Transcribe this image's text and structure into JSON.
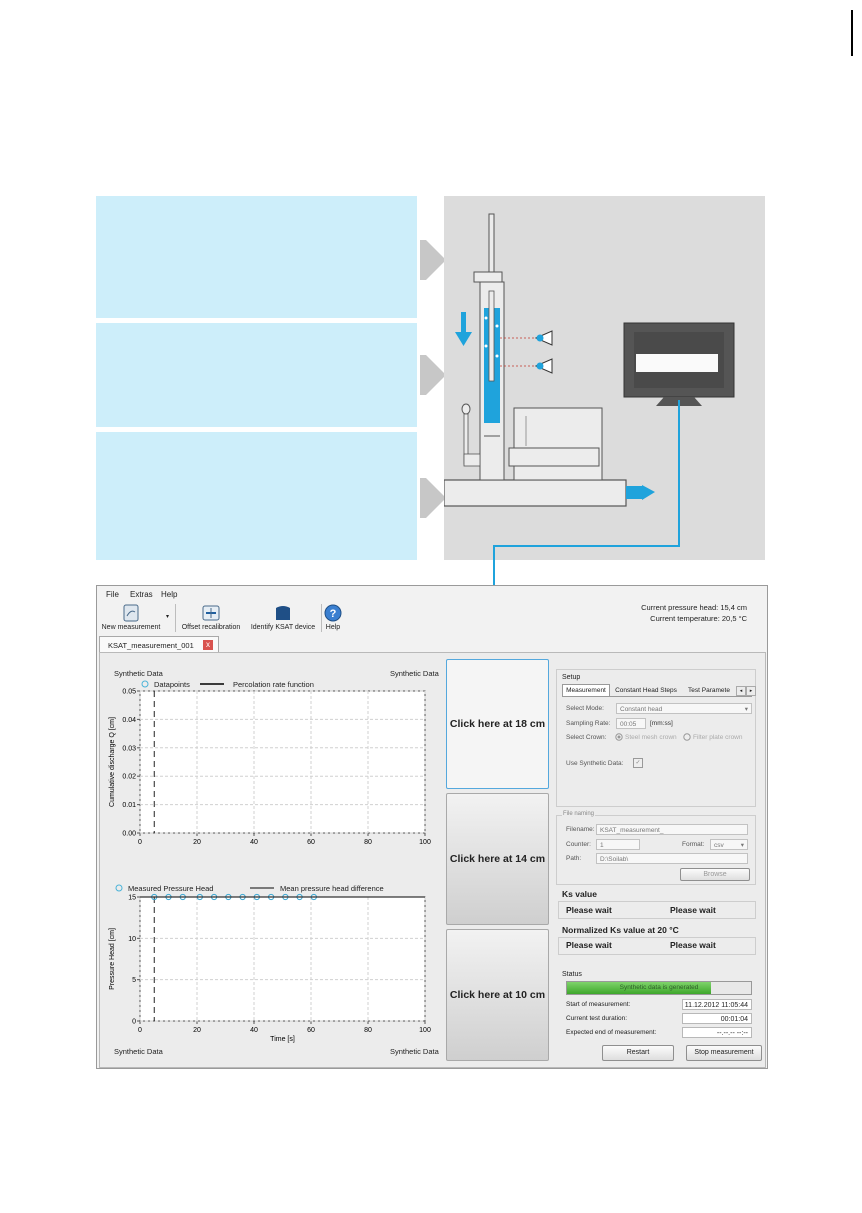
{
  "window": {
    "menu": [
      "File",
      "Extras",
      "Help"
    ],
    "toolbar": {
      "new_measurement": "New measurement",
      "offset_recalibration": "Offset recalibration",
      "identify_device": "Identify KSAT device",
      "help": "Help"
    },
    "status": {
      "pressure_head_label": "Current pressure head:",
      "pressure_head_value": "15,4 cm",
      "temperature_label": "Current temperature:",
      "temperature_value": "20,5 °C"
    },
    "tab": {
      "label": "KSAT_measurement_001",
      "close": "x"
    }
  },
  "charts_text": {
    "synthetic": "Synthetic Data",
    "legend_top_1": "Datapoints",
    "legend_top_2": "Percolation rate function",
    "legend_bottom_1": "Measured Pressure Head",
    "legend_bottom_2": "Mean pressure head difference"
  },
  "chart_data": [
    {
      "type": "line",
      "xlabel": "",
      "ylabel": "Cumulative discharge Q [cm]",
      "xlim": [
        0,
        100
      ],
      "ylim": [
        0,
        0.05
      ],
      "xticks": [
        "0",
        "20",
        "40",
        "60",
        "80",
        "100"
      ],
      "yticks": [
        "0.00",
        "0.01",
        "0.02",
        "0.03",
        "0.04",
        "0.05"
      ],
      "legend": [
        "Datapoints",
        "Percolation rate function"
      ],
      "series": [],
      "vline_x": 5,
      "grid": true
    },
    {
      "type": "scatter",
      "xlabel": "Time [s]",
      "ylabel": "Pressure Head [cm]",
      "xlim": [
        0,
        100
      ],
      "ylim": [
        0,
        15
      ],
      "xticks": [
        "0",
        "20",
        "40",
        "60",
        "80",
        "100"
      ],
      "yticks": [
        "0",
        "5",
        "10",
        "15"
      ],
      "legend": [
        "Measured Pressure Head",
        "Mean pressure head difference"
      ],
      "series": [
        {
          "name": "Measured Pressure Head",
          "x": [
            5,
            10,
            15,
            21,
            26,
            31,
            36,
            41,
            46,
            51,
            56,
            61
          ],
          "y": [
            15,
            15,
            15,
            15,
            15,
            15,
            15,
            15,
            15,
            15,
            15,
            15
          ]
        },
        {
          "name": "Mean pressure head difference",
          "x": [
            0,
            100
          ],
          "y": [
            15,
            15
          ]
        }
      ],
      "vline_x": 5,
      "grid": true
    }
  ],
  "buttons": {
    "btn18": "Click here at 18 cm",
    "btn14": "Click here at 14 cm",
    "btn10": "Click here at 10 cm"
  },
  "setup": {
    "title": "Setup",
    "tabs": [
      "Measurement",
      "Constant Head Steps",
      "Test Paramete"
    ],
    "select_mode_label": "Select Mode:",
    "select_mode_value": "Constant head",
    "sampling_rate_label": "Sampling Rate:",
    "sampling_rate_value": "00:05",
    "sampling_rate_unit": "[mm:ss]",
    "select_crown_label": "Select Crown:",
    "crown_option_1": "Steel mesh crown",
    "crown_option_2": "Filter plate crown",
    "use_synthetic_label": "Use Synthetic Data:"
  },
  "file_naming": {
    "title": "File naming",
    "filename_label": "Filename:",
    "filename_value": "KSAT_measurement_",
    "counter_label": "Counter:",
    "counter_value": "1",
    "format_label": "Format:",
    "format_value": "csv",
    "path_label": "Path:",
    "path_value": "D:\\Soilab\\",
    "browse": "Browse"
  },
  "ks": {
    "title": "Ks value",
    "wait1": "Please wait",
    "wait2": "Please wait",
    "norm_title": "Normalized Ks value at 20 °C",
    "wait3": "Please wait",
    "wait4": "Please wait"
  },
  "status_panel": {
    "title": "Status",
    "progress_text": "Synthetic data is generated",
    "progress": 0.78,
    "start_label": "Start of measurement:",
    "start_value": "11.12.2012 11:05:44",
    "duration_label": "Current test duration:",
    "duration_value": "00:01:04",
    "end_label": "Expected end of measurement:",
    "end_value": "--.--.-- --:--",
    "restart": "Restart",
    "stop": "Stop measurement"
  },
  "colors": {
    "accent": "#1fa3dc",
    "light_blue": "#cdeefa",
    "panel_gray": "#dcdcdc"
  }
}
